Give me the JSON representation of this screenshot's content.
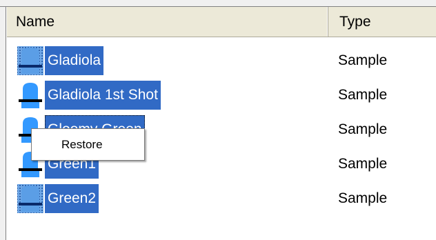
{
  "columns": {
    "name": "Name",
    "type": "Type"
  },
  "rows": [
    {
      "name": "Gladiola",
      "type": "Sample",
      "icon": "sample-stitched-icon"
    },
    {
      "name": "Gladiola 1st Shot",
      "type": "Sample",
      "icon": "sample-icon"
    },
    {
      "name": "Gloomy Green",
      "type": "Sample",
      "icon": "sample-icon"
    },
    {
      "name": "Green1",
      "type": "Sample",
      "icon": "sample-icon"
    },
    {
      "name": "Green2",
      "type": "Sample",
      "icon": "sample-stitched-icon"
    }
  ],
  "context_menu": {
    "items": [
      {
        "label": "Restore"
      }
    ]
  },
  "colors": {
    "selection": "#316ac5",
    "header": "#ece9d8",
    "icon_blue": "#3399ff"
  }
}
